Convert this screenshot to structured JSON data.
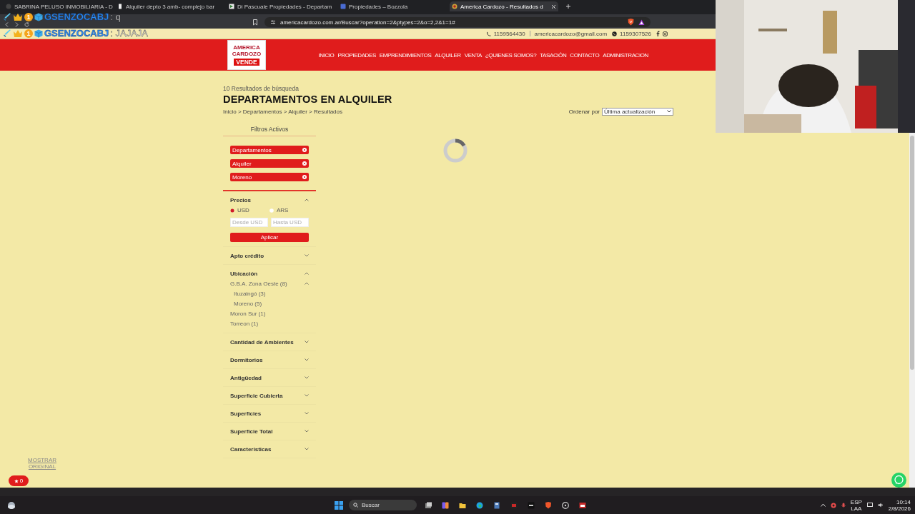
{
  "browser": {
    "tabs": [
      {
        "title": "SABRINA PELUSO INMOBILIARIA - D",
        "selected": false
      },
      {
        "title": "Alquiler depto 3 amb- complejo bar",
        "selected": false
      },
      {
        "title": "Di Pascuale Propiedades - Departam",
        "selected": false
      },
      {
        "title": "Propiedades – Bozzola",
        "selected": false
      },
      {
        "title": "America Cardozo - Resultados d",
        "selected": true
      }
    ],
    "address": "americacardozo.com.ar/Buscar?operation=2&ptypes=2&o=2,2&1=1#"
  },
  "chat_overlay": [
    {
      "badge": "1",
      "user": "GSENZOCABJ",
      "message": ": q"
    },
    {
      "badge": "1",
      "user": "GSENZOCABJ",
      "message": ": JAJAJA"
    }
  ],
  "topbar": {
    "phone": "1159564430",
    "email": "americacardozo@gmail.com",
    "whatsapp": "1159307526"
  },
  "header": {
    "logo": [
      "AMERICA",
      "CARDOZO",
      "VENDE"
    ],
    "nav": [
      "INICIO",
      "PROPIEDADES",
      "EMPRENDIMIENTOS",
      "ALQUILER",
      "VENTA",
      "¿QUIENES SOMOS?",
      "TASACIÓN",
      "CONTACTO",
      "ADMINISTRACION"
    ]
  },
  "results": {
    "count": "10 Resultados de búsqueda",
    "title": "DEPARTAMENTOS EN ALQUILER",
    "breadcrumb": "Inicio > Departamentos > Alquiler > Resultados",
    "sort_label": "Ordenar por",
    "sort_value": "Última actualización"
  },
  "filters": {
    "active_title": "Filtros Activos",
    "active": [
      "Departamentos",
      "Alquiler",
      "Moreno"
    ],
    "sections": [
      {
        "title": "Precios",
        "kind": "price",
        "expanded": true,
        "currencies": [
          {
            "label": "USD",
            "selected": true
          },
          {
            "label": "ARS",
            "selected": false
          }
        ],
        "from_placeholder": "Desde USD",
        "to_placeholder": "Hasta USD",
        "button": "Aplicar"
      },
      {
        "title": "Apto crédito",
        "kind": "plain",
        "expanded": false
      },
      {
        "title": "Ubicación",
        "kind": "tree",
        "expanded": true,
        "items": [
          {
            "label": "G.B.A. Zona Oeste (8)",
            "expanded": true,
            "children": [
              {
                "label": "Ituzaingó (3)"
              },
              {
                "label": "Moreno (5)"
              }
            ]
          },
          {
            "label": "Moron Sur (1)"
          },
          {
            "label": "Torreon (1)"
          }
        ]
      },
      {
        "title": "Cantidad de Ambientes",
        "kind": "plain",
        "expanded": false
      },
      {
        "title": "Dormitorios",
        "kind": "plain",
        "expanded": false
      },
      {
        "title": "Antigüedad",
        "kind": "plain",
        "expanded": false
      },
      {
        "title": "Superficie Cubierta",
        "kind": "plain",
        "expanded": false
      },
      {
        "title": "Superficies",
        "kind": "plain",
        "expanded": false
      },
      {
        "title": "Superficie Total",
        "kind": "plain",
        "expanded": false
      },
      {
        "title": "Caracteristicas",
        "kind": "plain",
        "expanded": false
      }
    ]
  },
  "floating": {
    "show_original": "MOSTRAR ORIGINAL",
    "favorites_count": "0"
  },
  "taskbar": {
    "search": "Buscar",
    "language": "ESP",
    "layout": "LAA",
    "time": "10:14",
    "date": "2/8/2026"
  }
}
